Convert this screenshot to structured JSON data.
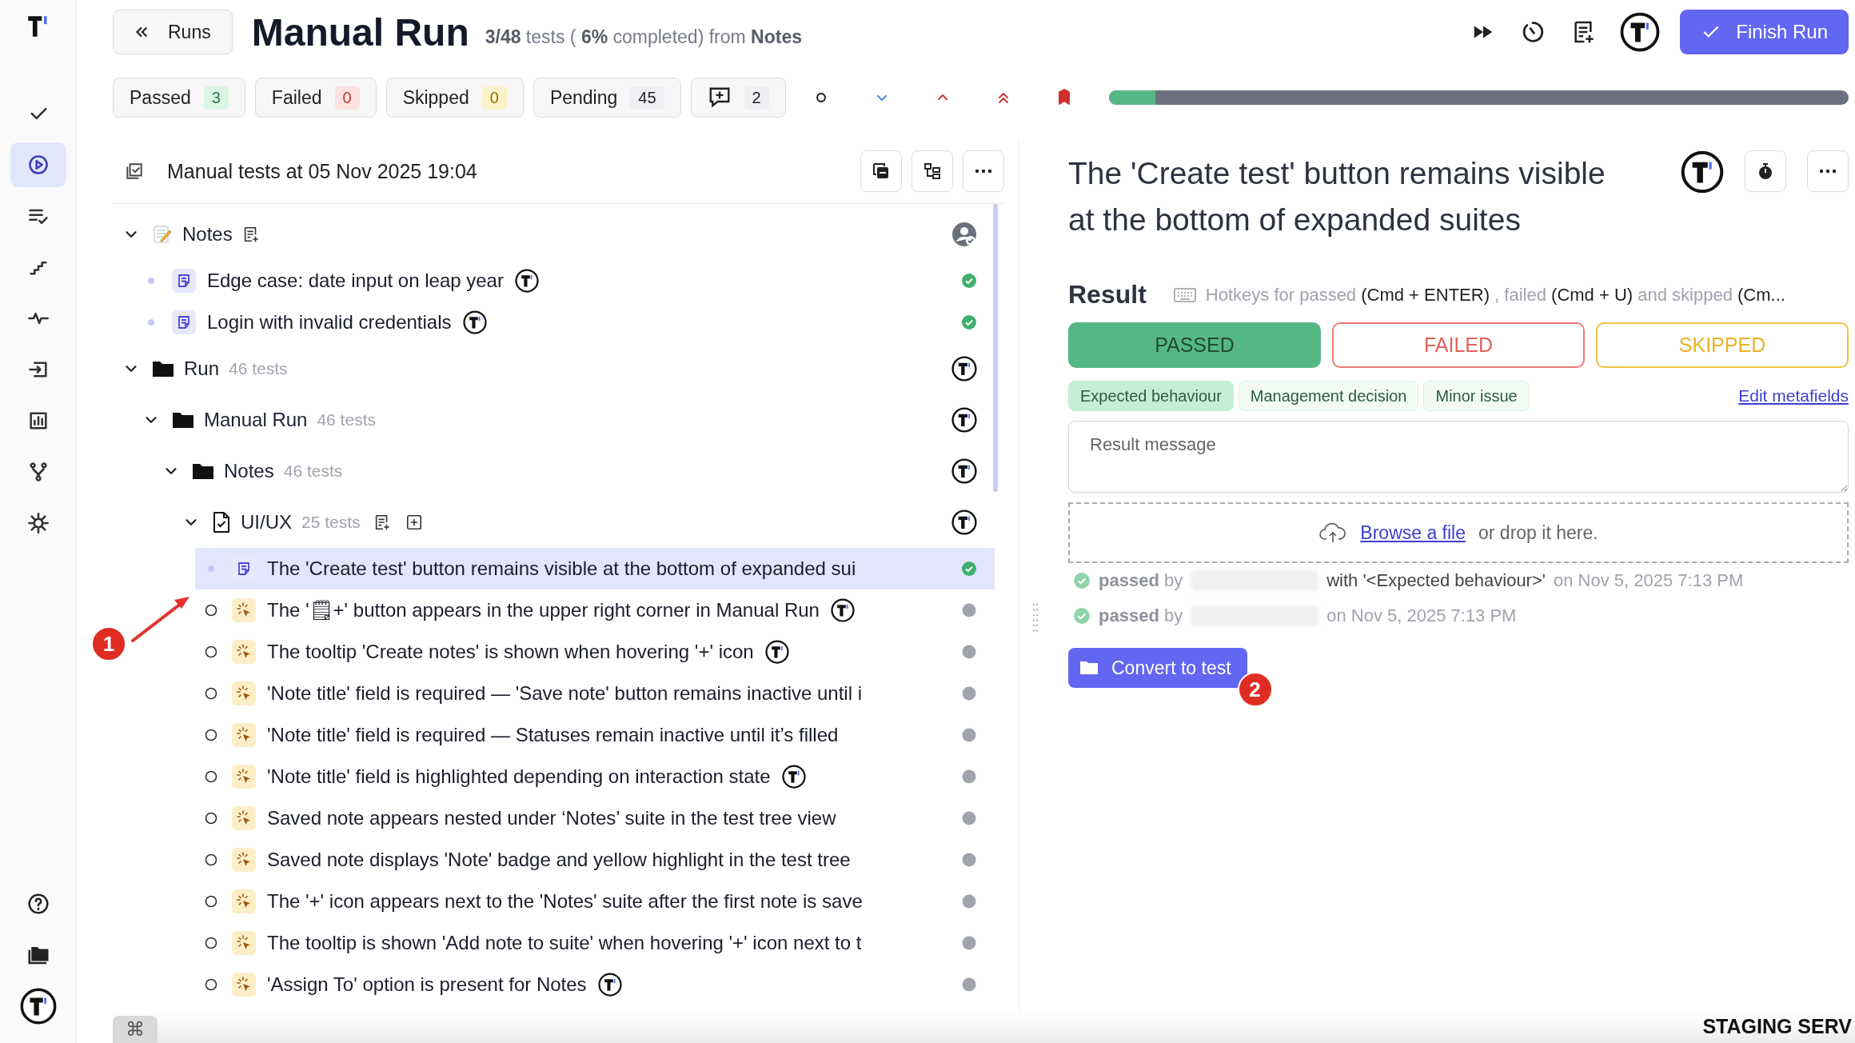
{
  "sidebar": {
    "items": [
      {
        "kind": "check",
        "selected": false
      },
      {
        "kind": "play",
        "selected": true
      },
      {
        "kind": "list-check",
        "selected": false
      },
      {
        "kind": "stairs",
        "selected": false
      },
      {
        "kind": "pulse",
        "selected": false
      },
      {
        "kind": "import",
        "selected": false
      },
      {
        "kind": "chart",
        "selected": false
      },
      {
        "kind": "branch",
        "selected": false
      },
      {
        "kind": "gear",
        "selected": false
      }
    ],
    "bottom_items": [
      {
        "kind": "help"
      },
      {
        "kind": "folders"
      },
      {
        "kind": "badge"
      }
    ]
  },
  "header": {
    "back_button": "Runs",
    "title": "Manual Run",
    "summary": "**3/48** tests ( **6%** completed) from **Notes**",
    "finish_button": "Finish Run"
  },
  "filters": [
    {
      "kind": "passed",
      "label": "Passed",
      "count": "3"
    },
    {
      "kind": "failed",
      "label": "Failed",
      "count": "0"
    },
    {
      "kind": "skipped",
      "label": "Skipped",
      "count": "0"
    },
    {
      "kind": "pending",
      "label": "Pending",
      "count": "45"
    },
    {
      "kind": "notes",
      "count": "2"
    }
  ],
  "priority_filters": [
    {
      "kind": "none"
    },
    {
      "kind": "low"
    },
    {
      "kind": "high"
    },
    {
      "kind": "critical"
    },
    {
      "kind": "flagged"
    }
  ],
  "progress": {
    "level": 0.063
  },
  "tree_panel": {
    "title": "Manual tests at 05 Nov 2025 19:04",
    "tree": [
      {
        "kind": "notes-suite",
        "label": "Notes",
        "expanded": true,
        "tools": [
          {
            "kind": "add-note"
          }
        ],
        "owner": {
          "kind": "person"
        },
        "children": [
          {
            "kind": "note",
            "label": "Edge case: date input on leap year",
            "assigned": true,
            "passed": true,
            "selected": false
          },
          {
            "kind": "note",
            "label": "Login with invalid credentials",
            "assigned": true,
            "passed": true,
            "selected": false
          }
        ]
      },
      {
        "kind": "folder",
        "label": "Run",
        "count": "46 tests",
        "expanded": true,
        "owner": {
          "kind": "badge"
        },
        "children": [
          {
            "kind": "folder",
            "label": "Manual Run",
            "count": "46 tests",
            "expanded": true,
            "owner": {
              "kind": "badge"
            },
            "children": [
              {
                "kind": "folder",
                "label": "Notes",
                "count": "46 tests",
                "expanded": true,
                "owner": {
                  "kind": "badge"
                },
                "children": [
                  {
                    "kind": "file",
                    "label": "UI/UX",
                    "count": "25 tests",
                    "expanded": true,
                    "tools": [
                      {
                        "kind": "add-note"
                      },
                      {
                        "kind": "add-test"
                      }
                    ],
                    "owner": {
                      "kind": "badge"
                    },
                    "children": [
                      {
                        "kind": "note",
                        "label": "The 'Create test' button remains visible at the bottom of expanded sui",
                        "assigned": false,
                        "passed": true,
                        "selected": true
                      },
                      {
                        "kind": "manual",
                        "label": "The '🗒+' button appears in the upper right corner in Manual Run",
                        "assigned": true,
                        "passed": false,
                        "selected": false
                      },
                      {
                        "kind": "manual",
                        "label": "The tooltip 'Create notes' is shown when hovering '+' icon",
                        "assigned": true,
                        "passed": false,
                        "selected": false
                      },
                      {
                        "kind": "manual",
                        "label": "'Note title' field is required — 'Save note' button remains inactive until i",
                        "assigned": false,
                        "passed": false,
                        "selected": false
                      },
                      {
                        "kind": "manual",
                        "label": "'Note title' field is required — Statuses remain inactive until it’s filled",
                        "assigned": false,
                        "passed": false,
                        "selected": false
                      },
                      {
                        "kind": "manual",
                        "label": "'Note title' field is highlighted depending on interaction state",
                        "assigned": true,
                        "passed": false,
                        "selected": false
                      },
                      {
                        "kind": "manual",
                        "label": "Saved note appears nested under ‘Notes’ suite in the test tree view",
                        "assigned": false,
                        "passed": false,
                        "selected": false
                      },
                      {
                        "kind": "manual",
                        "label": "Saved note displays 'Note' badge and yellow highlight in the test tree",
                        "assigned": false,
                        "passed": false,
                        "selected": false
                      },
                      {
                        "kind": "manual",
                        "label": "The '+' icon appears next to the 'Notes' suite after the first note is save",
                        "assigned": false,
                        "passed": false,
                        "selected": false
                      },
                      {
                        "kind": "manual",
                        "label": "The tooltip is shown 'Add note to suite' when hovering '+' icon next to t",
                        "assigned": false,
                        "passed": false,
                        "selected": false
                      },
                      {
                        "kind": "manual",
                        "label": "'Assign To' option is present for Notes",
                        "assigned": true,
                        "passed": false,
                        "selected": false
                      }
                    ]
                  }
                ]
              }
            ]
          }
        ]
      }
    ]
  },
  "detail": {
    "title": "The 'Create test' button remains visible at the bottom of expanded suites",
    "result_heading": "Result",
    "hotkeys": [
      {
        "text": "Hotkeys for passed",
        "kind": "hint"
      },
      {
        "text": "(Cmd + ENTER)",
        "kind": "key"
      },
      {
        "text": ", failed",
        "kind": "hint"
      },
      {
        "text": "(Cmd + U)",
        "kind": "key"
      },
      {
        "text": "and skipped",
        "kind": "hint"
      },
      {
        "text": "(Cm...",
        "kind": "key"
      }
    ],
    "result_buttons": [
      {
        "kind": "passed",
        "label": "PASSED",
        "selected": true
      },
      {
        "kind": "failed",
        "label": "FAILED",
        "selected": false
      },
      {
        "kind": "skipped",
        "label": "SKIPPED",
        "selected": false
      }
    ],
    "chips": [
      {
        "label": "Expected behaviour",
        "selected": true
      },
      {
        "label": "Management decision",
        "selected": false
      },
      {
        "label": "Minor issue",
        "selected": false
      }
    ],
    "edit_link": "Edit metafields",
    "message": {
      "placeholder": "Result message"
    },
    "upload": {
      "link": "Browse a file",
      "text": "or drop it here."
    },
    "history": [
      {
        "passed": true,
        "label": "**passed** by",
        "detail": "with '<Expected behaviour>'",
        "date": "on Nov 5, 2025 7:13 PM"
      },
      {
        "passed": true,
        "label": "**passed** by",
        "date": "on Nov 5, 2025 7:13 PM"
      }
    ],
    "convert_button": "Convert to test"
  },
  "annotations": [
    {
      "kind": "arrow",
      "label": "1"
    },
    {
      "kind": "badge",
      "label": "2"
    }
  ],
  "footer": {
    "key": "⌘",
    "environment": "STAGING SERV"
  }
}
